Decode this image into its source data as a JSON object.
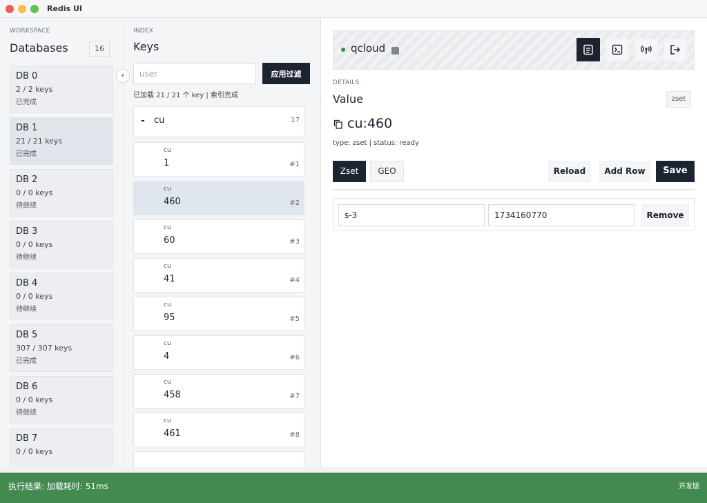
{
  "app": {
    "title": "Redis UI"
  },
  "sidebar": {
    "section_label": "WORKSPACE",
    "heading": "Databases",
    "db_count": "16",
    "databases": [
      {
        "name": "DB 0",
        "keys": "2 / 2 keys",
        "status": "已完成"
      },
      {
        "name": "DB 1",
        "keys": "21 / 21 keys",
        "status": "已完成"
      },
      {
        "name": "DB 2",
        "keys": "0 / 0 keys",
        "status": "待继续"
      },
      {
        "name": "DB 3",
        "keys": "0 / 0 keys",
        "status": "待继续"
      },
      {
        "name": "DB 4",
        "keys": "0 / 0 keys",
        "status": "待继续"
      },
      {
        "name": "DB 5",
        "keys": "307 / 307 keys",
        "status": "已完成"
      },
      {
        "name": "DB 6",
        "keys": "0 / 0 keys",
        "status": "待继续"
      },
      {
        "name": "DB 7",
        "keys": "0 / 0 keys",
        "status": ""
      }
    ]
  },
  "keys_panel": {
    "section_label": "INDEX",
    "heading": "Keys",
    "filter_value": "",
    "filter_placeholder": "user",
    "apply_label": "应用过滤",
    "load_info": "已加载 21 / 21 个 key | 索引完成",
    "group": {
      "dash": "-",
      "name": "cu",
      "count": "17"
    },
    "keys": [
      {
        "prefix": "cu",
        "name": "1",
        "index": "#1"
      },
      {
        "prefix": "cu",
        "name": "460",
        "index": "#2"
      },
      {
        "prefix": "cu",
        "name": "60",
        "index": "#3"
      },
      {
        "prefix": "cu",
        "name": "41",
        "index": "#4"
      },
      {
        "prefix": "cu",
        "name": "95",
        "index": "#5"
      },
      {
        "prefix": "cu",
        "name": "4",
        "index": "#6"
      },
      {
        "prefix": "cu",
        "name": "458",
        "index": "#7"
      },
      {
        "prefix": "cu",
        "name": "461",
        "index": "#8"
      }
    ]
  },
  "connection": {
    "name": "qcloud",
    "status_color": "#3d8a4c"
  },
  "details": {
    "section_label": "DETAILS",
    "heading": "Value",
    "type_badge": "zset",
    "key_title": "cu:460",
    "meta": "type: zset | status: ready",
    "tabs": [
      "Zset",
      "GEO"
    ],
    "reload_label": "Reload",
    "add_row_label": "Add Row",
    "save_label": "Save",
    "row": {
      "member": "s-3",
      "score": "1734160770",
      "remove_label": "Remove"
    }
  },
  "statusbar": {
    "text": "执行结果: 加载耗时: 51ms",
    "right": "开发版",
    "color": "#428a50"
  }
}
